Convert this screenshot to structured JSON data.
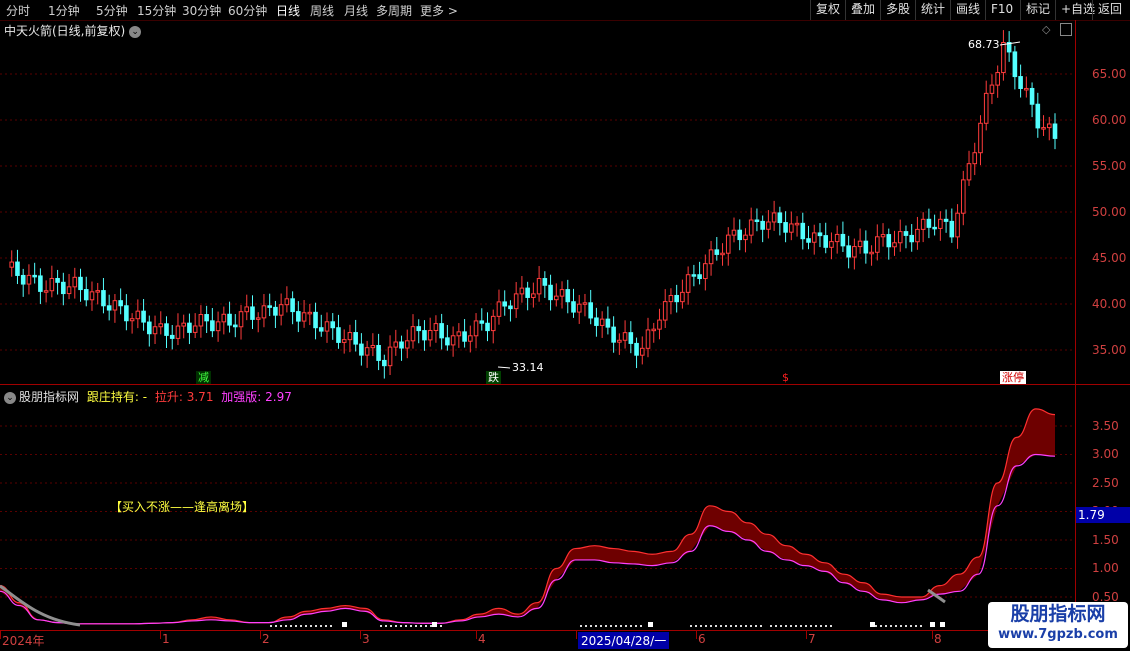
{
  "toolbar": {
    "periods": [
      "分时",
      "1分钟",
      "5分钟",
      "15分钟",
      "30分钟",
      "60分钟",
      "日线",
      "周线",
      "月线",
      "多周期",
      "更多 >"
    ],
    "active_period": "日线",
    "right_buttons": [
      "复权",
      "叠加",
      "多股",
      "统计",
      "画线",
      "F10",
      "标记",
      "+自选",
      "返回"
    ]
  },
  "stock": {
    "title": "中天火箭(日线,前复权)",
    "high_label": "68.73",
    "low_label": "33.14"
  },
  "price_axis": {
    "ticks": [
      "65.00",
      "60.00",
      "55.00",
      "50.00",
      "45.00",
      "40.00",
      "35.00"
    ]
  },
  "signals": [
    {
      "text": "减",
      "color": "#00c800"
    },
    {
      "text": "跌",
      "color": "#00c800"
    },
    {
      "text": "$",
      "color": "#ff2020"
    },
    {
      "text": "涨停",
      "color": "#ff2020"
    }
  ],
  "indicator": {
    "name": "股朋指标网",
    "label1": "跟庄持有: -",
    "label2": "拉升: 3.71",
    "label3": "加强版: 2.97",
    "annotation": "【买入不涨——逢高离场】",
    "current_value": "1.79",
    "axis_ticks": [
      "3.50",
      "3.00",
      "2.50",
      "2.00",
      "1.50",
      "1.00",
      "0.50"
    ]
  },
  "date_axis": {
    "items": [
      "2024年",
      "1",
      "2",
      "3",
      "4",
      "2025/04/28/一",
      "6",
      "7",
      "8"
    ]
  },
  "watermark": {
    "line1": "股朋指标网",
    "line2": "www.7gpzb.com"
  },
  "colors": {
    "up": "#ff3c3c",
    "down": "#54ffff",
    "axis": "#a00000",
    "band": "#6e0000",
    "magenta": "#ff40ff"
  },
  "chart_data": {
    "type": "candlestick",
    "price_range": [
      32,
      70
    ],
    "close_series": [
      44,
      43,
      42,
      42,
      42,
      41,
      40,
      39,
      38,
      37,
      37,
      38,
      38,
      38,
      39,
      39,
      40,
      39,
      38,
      37,
      36,
      35,
      34,
      36,
      37,
      37,
      36,
      37,
      38,
      40,
      41,
      42,
      41,
      40,
      39,
      37,
      36,
      35,
      39,
      41,
      43,
      45,
      47,
      48,
      49,
      49,
      48,
      47,
      47,
      46,
      46,
      47,
      47,
      48,
      49,
      48,
      55,
      62,
      68,
      64,
      60,
      58
    ],
    "indicator_range": [
      0,
      4
    ],
    "indicator_band_top": [
      0.7,
      0.4,
      0.1,
      0.05,
      0.03,
      0.03,
      0.03,
      0.03,
      0.04,
      0.05,
      0.1,
      0.15,
      0.1,
      0.05,
      0.05,
      0.15,
      0.25,
      0.3,
      0.35,
      0.3,
      0.1,
      0.05,
      0.04,
      0.04,
      0.1,
      0.2,
      0.3,
      0.2,
      0.4,
      1.0,
      1.35,
      1.4,
      1.35,
      1.3,
      1.25,
      1.3,
      1.6,
      2.1,
      2.0,
      1.8,
      1.6,
      1.4,
      1.25,
      1.1,
      0.9,
      0.75,
      0.55,
      0.5,
      0.5,
      0.7,
      0.9,
      1.2,
      2.5,
      3.3,
      3.8,
      3.7
    ],
    "indicator_band_bottom": [
      0.6,
      0.35,
      0.1,
      0.05,
      0.03,
      0.03,
      0.03,
      0.03,
      0.04,
      0.05,
      0.08,
      0.1,
      0.08,
      0.05,
      0.05,
      0.1,
      0.2,
      0.25,
      0.3,
      0.25,
      0.08,
      0.05,
      0.04,
      0.04,
      0.08,
      0.15,
      0.2,
      0.15,
      0.3,
      0.8,
      1.15,
      1.15,
      1.1,
      1.08,
      1.05,
      1.1,
      1.3,
      1.75,
      1.65,
      1.5,
      1.3,
      1.15,
      1.05,
      0.95,
      0.75,
      0.6,
      0.45,
      0.4,
      0.45,
      0.55,
      0.6,
      0.9,
      2.1,
      2.8,
      3.0,
      2.97
    ]
  }
}
